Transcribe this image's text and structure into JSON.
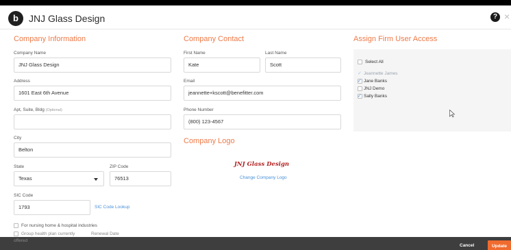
{
  "header": {
    "logo_letter": "b",
    "title": "JNJ Glass Design",
    "help_icon": "?",
    "close_icon": "×"
  },
  "company_info": {
    "title": "Company Information",
    "company_name_label": "Company Name",
    "company_name": "JNJ Glass Design",
    "address_label": "Address",
    "address": "1601 East 6th Avenue",
    "apt_label": "Apt, Suite, Bldg",
    "apt_optional": "(Optional)",
    "apt": "",
    "city_label": "City",
    "city": "Belton",
    "state_label": "State",
    "state": "Texas",
    "zip_label": "ZIP Code",
    "zip": "76513",
    "sic_label": "SIC Code",
    "sic": "1793",
    "sic_lookup": "SIC Code Lookup",
    "nursing_label": "For nursing home & hospital industries",
    "group_health_label": "Group health plan currently",
    "offered_label": "offered",
    "renewal_label": "Renewal Date"
  },
  "company_contact": {
    "title": "Company Contact",
    "first_name_label": "First Name",
    "first_name": "Kate",
    "last_name_label": "Last Name",
    "last_name": "Scott",
    "email_label": "Email",
    "email": "jeannette+kscott@benefitter.com",
    "phone_label": "Phone Number",
    "phone": "(800) 123-4567"
  },
  "company_logo": {
    "title": "Company Logo",
    "logo_text": "JNJ Glass Design",
    "change_link": "Change Company Logo"
  },
  "firm_access": {
    "title": "Assign Firm User Access",
    "select_all": "Select All",
    "users": [
      {
        "name": "Jeannette James",
        "checked": true
      },
      {
        "name": "Jane Banks",
        "checked": true
      },
      {
        "name": "JNJ Demo",
        "checked": false
      },
      {
        "name": "Sally Banks",
        "checked": true
      }
    ]
  },
  "footer": {
    "cancel": "Cancel",
    "update": "Update"
  },
  "colors": {
    "accent": "#ee7a48",
    "link": "#4a90d9",
    "update_button": "#f06b2e",
    "footer_bg": "#3e3e3e"
  }
}
